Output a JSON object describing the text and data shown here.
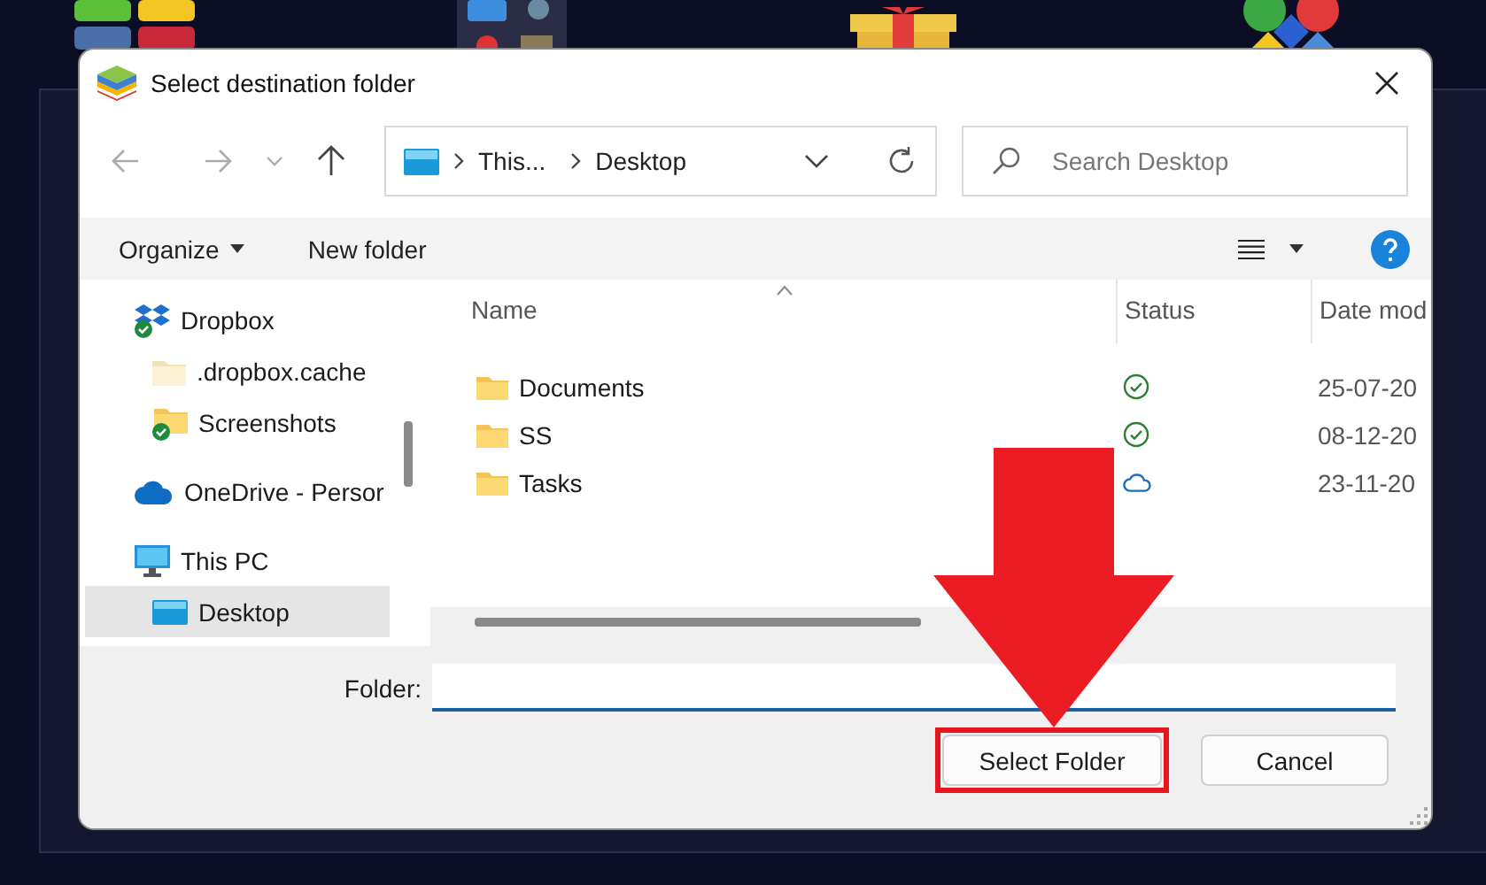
{
  "window": {
    "title": "Select destination folder"
  },
  "address": {
    "crumbs": [
      "This...",
      "Desktop"
    ]
  },
  "search": {
    "placeholder": "Search Desktop"
  },
  "toolbar": {
    "organize": "Organize",
    "new_folder": "New folder"
  },
  "sidebar": {
    "items": [
      {
        "label": "Dropbox",
        "kind": "dropbox",
        "selected": false,
        "children": [
          {
            "label": ".dropbox.cache",
            "kind": "folder-plain",
            "selected": false
          },
          {
            "label": "Screenshots",
            "kind": "folder-synced",
            "selected": false
          }
        ]
      },
      {
        "label": "OneDrive - Persor",
        "kind": "onedrive",
        "selected": false
      },
      {
        "label": "This PC",
        "kind": "pc",
        "selected": false,
        "children": [
          {
            "label": "Desktop",
            "kind": "desktop",
            "selected": true
          }
        ]
      }
    ]
  },
  "table": {
    "columns": [
      "Name",
      "Status",
      "Date mod"
    ],
    "rows": [
      {
        "name": "Documents",
        "kind": "synced",
        "date": "25-07-20"
      },
      {
        "name": "SS",
        "kind": "synced",
        "date": "08-12-20"
      },
      {
        "name": "Tasks",
        "kind": "cloud",
        "date": "23-11-20"
      }
    ]
  },
  "folder_field": {
    "label": "Folder:"
  },
  "buttons": [
    {
      "label": "Select Folder",
      "highlighted": true
    },
    {
      "label": "Cancel",
      "highlighted": false
    }
  ]
}
